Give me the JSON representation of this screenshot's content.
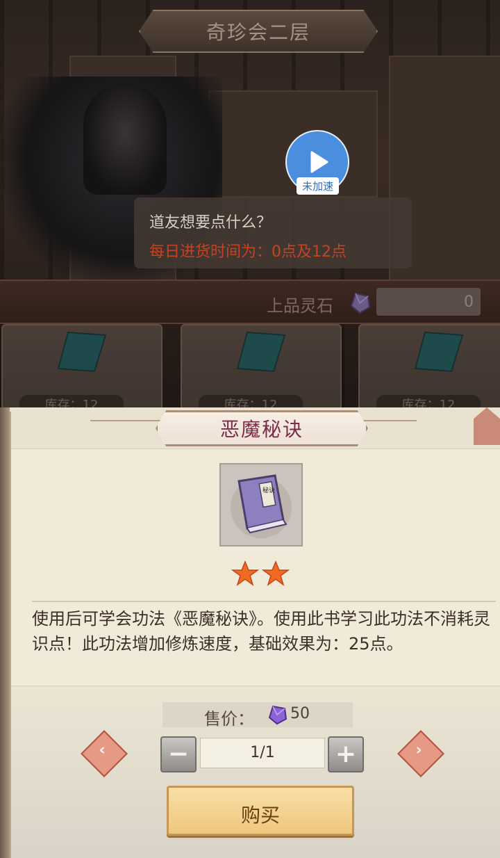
{
  "header": {
    "title": "奇珍会二层"
  },
  "speed_button": {
    "label": "未加速"
  },
  "dialog": {
    "line1": "道友想要点什么？",
    "line2": "每日进货时间为：0点及12点"
  },
  "currency": {
    "label": "上品灵石",
    "value": "0"
  },
  "goods": [
    {
      "stock_label": "库存：12"
    },
    {
      "stock_label": "库存：12"
    },
    {
      "stock_label": "库存：12"
    }
  ],
  "item": {
    "name": "恶魔秘诀",
    "book_label": "秘诀",
    "stars": 2,
    "description": "使用后可学会功法《恶魔秘诀》。使用此书学习此功法不消耗灵识点！此功法增加修炼速度，基础效果为：25点。"
  },
  "price": {
    "label": "售价：",
    "value": "50"
  },
  "quantity": {
    "value": "1/1"
  },
  "buy_button": {
    "label": "购买"
  },
  "colors": {
    "title_text": "#7b2d46",
    "dialog_highlight": "#c9421f",
    "speed_blue": "#4a8fde",
    "buy_button": "#efc77d"
  },
  "icons": [
    "play-icon",
    "crystal-icon",
    "book-icon",
    "star-icon",
    "minus-icon",
    "plus-icon",
    "arrow-left-icon",
    "arrow-right-icon"
  ]
}
